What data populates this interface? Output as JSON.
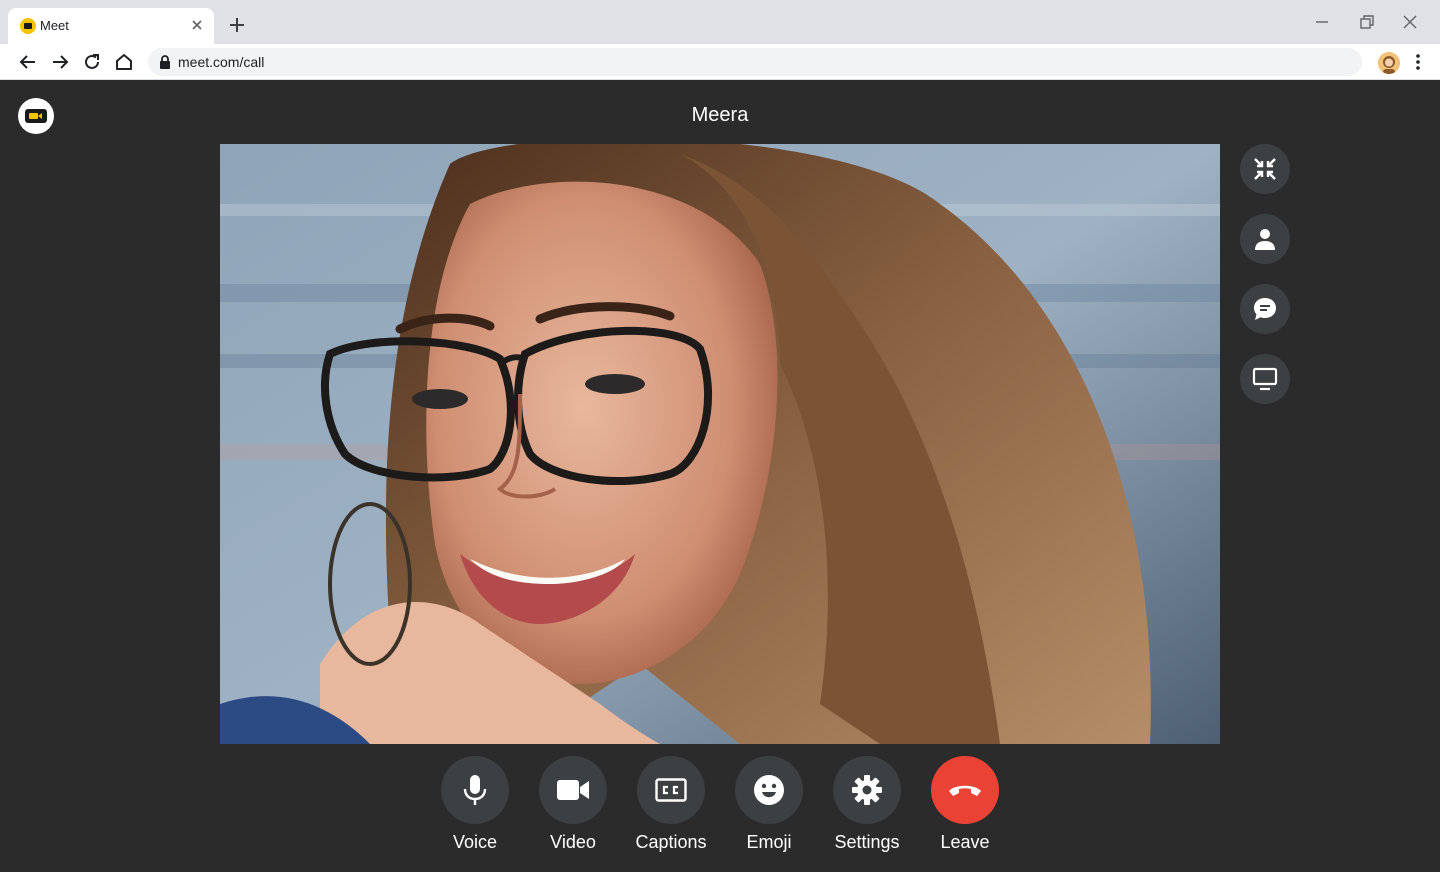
{
  "browser": {
    "tab_title": "Meet",
    "url": "meet.com/call"
  },
  "call": {
    "caller_name": "Meera"
  },
  "side_actions": [
    {
      "name": "minimize-icon"
    },
    {
      "name": "participants-icon"
    },
    {
      "name": "chat-icon"
    },
    {
      "name": "present-screen-icon"
    }
  ],
  "controls": {
    "voice": "Voice",
    "video": "Video",
    "captions": "Captions",
    "emoji": "Emoji",
    "settings": "Settings",
    "leave": "Leave"
  },
  "colors": {
    "background": "#2b2b2b",
    "button": "#3c4043",
    "leave": "#ea4335",
    "brand": "#f5c400"
  }
}
